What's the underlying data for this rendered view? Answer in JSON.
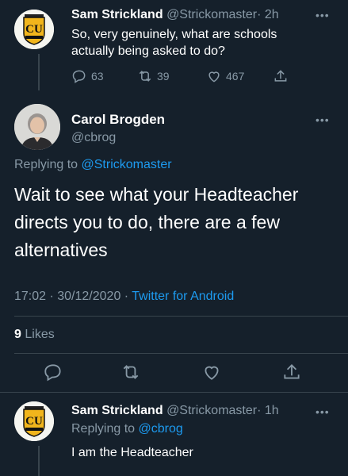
{
  "tweet1": {
    "name": "Sam Strickland",
    "handle": "@Strickomaster",
    "time": "· 2h",
    "text": "So, very genuinely, what are schools actually being asked to do?",
    "replies": "63",
    "retweets": "39",
    "likes": "467"
  },
  "main_tweet": {
    "name": "Carol Brogden",
    "handle": "@cbrog",
    "replying_prefix": "Replying to",
    "replying_handle": "@Strickomaster",
    "text": "Wait to see what your Headteacher directs you to do,  there are a few alternatives",
    "timestamp": "17:02 · 30/12/2020 ·",
    "source": "Twitter for Android",
    "likes_count": "9",
    "likes_label": "Likes"
  },
  "tweet3": {
    "name": "Sam Strickland",
    "handle": "@Strickomaster",
    "time": "· 1h",
    "replying_prefix": "Replying to",
    "replying_handle": "@cbrog",
    "text": "I am the Headteacher"
  },
  "club_logo_text": "CU",
  "colors": {
    "background": "#15202b",
    "accent": "#1d9bf0",
    "muted": "#8899a6",
    "divider": "#38444d"
  }
}
